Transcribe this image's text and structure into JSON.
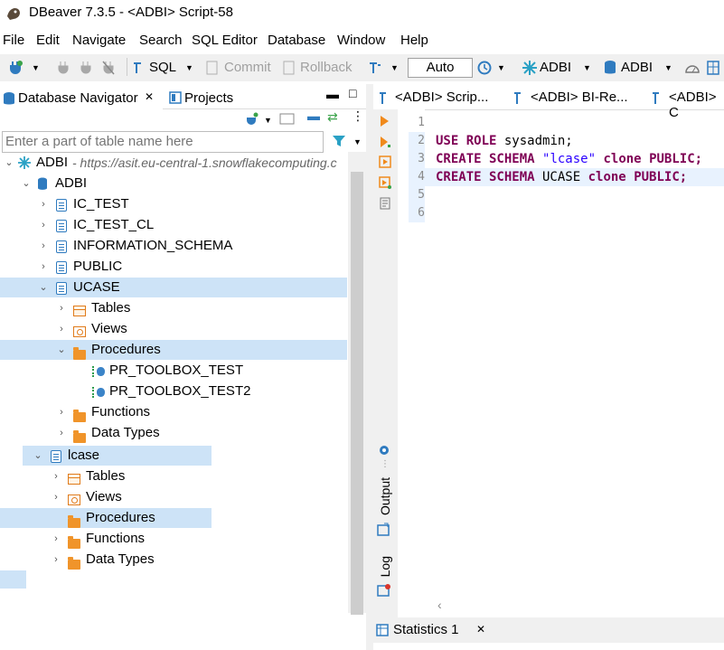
{
  "window": {
    "title": "DBeaver 7.3.5 - <ADBI> Script-58"
  },
  "menu": [
    "File",
    "Edit",
    "Navigate",
    "Search",
    "SQL Editor",
    "Database",
    "Window",
    "Help"
  ],
  "toolbar": {
    "sql_label": "SQL",
    "commit_label": "Commit",
    "rollback_label": "Rollback",
    "auto_label": "Auto",
    "datasource_label": "ADBI",
    "schema_label": "ADBI"
  },
  "left_tabs": {
    "navigator": "Database Navigator",
    "projects": "Projects"
  },
  "filter": {
    "placeholder": "Enter a part of table name here"
  },
  "tree": {
    "root": {
      "label": "ADBI",
      "url": " - https://asit.eu-central-1.snowflakecomputing.c"
    },
    "db": "ADBI",
    "schemas": [
      "IC_TEST",
      "IC_TEST_CL",
      "INFORMATION_SCHEMA",
      "PUBLIC",
      "UCASE"
    ],
    "ucase_children": [
      "Tables",
      "Views",
      "Procedures",
      "Functions",
      "Data Types"
    ],
    "procedures": [
      "PR_TOOLBOX_TEST",
      "PR_TOOLBOX_TEST2"
    ],
    "lcase": "lcase",
    "lcase_children": [
      "Tables",
      "Views",
      "Procedures",
      "Functions",
      "Data Types"
    ]
  },
  "editor_tabs": [
    "<ADBI> Scrip...",
    "<ADBI> BI-Re...",
    "<ADBI> C"
  ],
  "editor": {
    "line_numbers": [
      "1",
      "2",
      "3",
      "4",
      "5",
      "6"
    ],
    "line2": {
      "kw": "USE ROLE",
      "rest": " sysadmin;"
    },
    "line3": {
      "kw": "CREATE SCHEMA",
      "str": "\"lcase\"",
      "kw2": "clone",
      "kw3": "PUBLIC;"
    },
    "line4": {
      "kw": "CREATE SCHEMA",
      "name": " UCASE ",
      "kw2": "clone",
      "kw3": "PUBLIC;"
    }
  },
  "side_labels": {
    "output": "Output",
    "log": "Log"
  },
  "bottom": {
    "statistics": "Statistics 1"
  },
  "colors": {
    "selection": "#cde3f7",
    "keyword": "#7f0055",
    "string": "#2a00ff",
    "chrome": "#f0f0f0"
  }
}
